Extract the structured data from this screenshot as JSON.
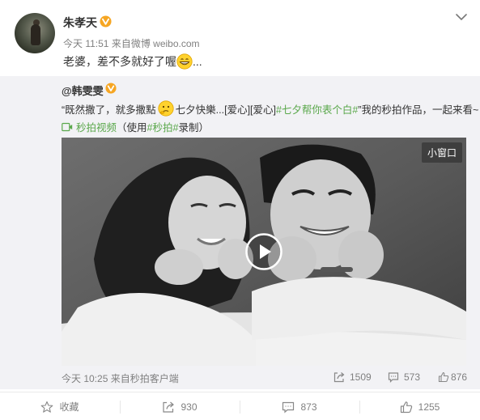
{
  "post": {
    "username": "朱孝天",
    "time": "今天 11:51",
    "source": "来自微博 weibo.com",
    "text": "老婆，差不多就好了喔",
    "text_suffix": "..."
  },
  "repost": {
    "username": "@韩雯雯",
    "text_part1": "“既然撒了，就多撒點",
    "text_part2": "七夕快樂...[爱心][爱心] ",
    "hashtag": "#七夕帮你表个白#",
    "text_part3": "”我的秒拍作品，一起来看~",
    "video_link_label": "秒拍视频",
    "used_prefix": "（使用",
    "used_hashtag": "#秒拍#",
    "used_suffix": "录制）",
    "mini_window_label": "小窗口",
    "time": "今天 10:25",
    "source": "来自秒拍客户端",
    "forward_count": "1509",
    "comment_count": "573",
    "like_count": "876"
  },
  "actions": {
    "favorite_label": "收藏",
    "forward_count": "930",
    "comment_count": "873",
    "like_count": "1255"
  },
  "colors": {
    "hashtag": "#5aa84b",
    "badge": "#f6a623",
    "muted": "#808080",
    "repost_bg": "#f2f2f5"
  }
}
